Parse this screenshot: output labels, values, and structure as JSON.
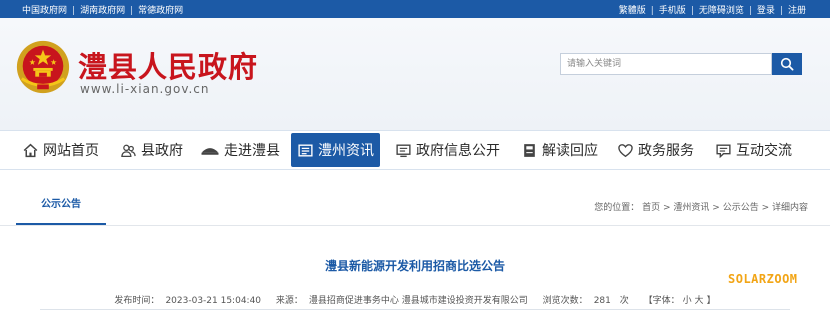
{
  "topbar": {
    "left_links": [
      "中国政府网",
      "湖南政府网",
      "常德政府网"
    ],
    "right_links": [
      "繁體版",
      "手机版",
      "无障碍浏览",
      "登录",
      "注册"
    ]
  },
  "header": {
    "title": "澧县人民政府",
    "url": "www.li-xian.gov.cn",
    "emblem_icon": "national-emblem-icon"
  },
  "search": {
    "placeholder": "请输入关键词",
    "button_icon": "search-icon"
  },
  "nav": {
    "items": [
      {
        "label": "网站首页",
        "icon": "home-icon",
        "active": false
      },
      {
        "label": "县政府",
        "icon": "people-icon",
        "active": false
      },
      {
        "label": "走进澧县",
        "icon": "building-icon",
        "active": false
      },
      {
        "label": "澧州资讯",
        "icon": "newspaper-icon",
        "active": true
      },
      {
        "label": "政府信息公开",
        "icon": "monitor-icon",
        "active": false
      },
      {
        "label": "解读回应",
        "icon": "book-icon",
        "active": false
      },
      {
        "label": "政务服务",
        "icon": "heart-icon",
        "active": false
      },
      {
        "label": "互动交流",
        "icon": "chat-icon",
        "active": false
      }
    ]
  },
  "section": {
    "tab_label": "公示公告",
    "breadcrumb_prefix": "您的位置：",
    "breadcrumb": [
      "首页",
      "澧州资讯",
      "公示公告",
      "详细内容"
    ],
    "breadcrumb_separator": " > "
  },
  "article": {
    "title": "澧县新能源开发利用招商比选公告",
    "publish_time_label": "发布时间：",
    "publish_time": "2023-03-21 15:04:40",
    "source_label": "来源：",
    "source": "澧县招商促进事务中心 澧县城市建设投资开发有限公司",
    "views_label": "浏览次数：",
    "views": "281",
    "views_unit": "次",
    "font_size_label": "【字体：",
    "font_small": "小",
    "font_large": "大",
    "font_size_close": "】"
  },
  "watermark": "SOLARZOOM",
  "colors": {
    "primary_blue": "#1c5aa6",
    "title_red": "#c8151d",
    "watermark_orange": "#f2a516"
  }
}
